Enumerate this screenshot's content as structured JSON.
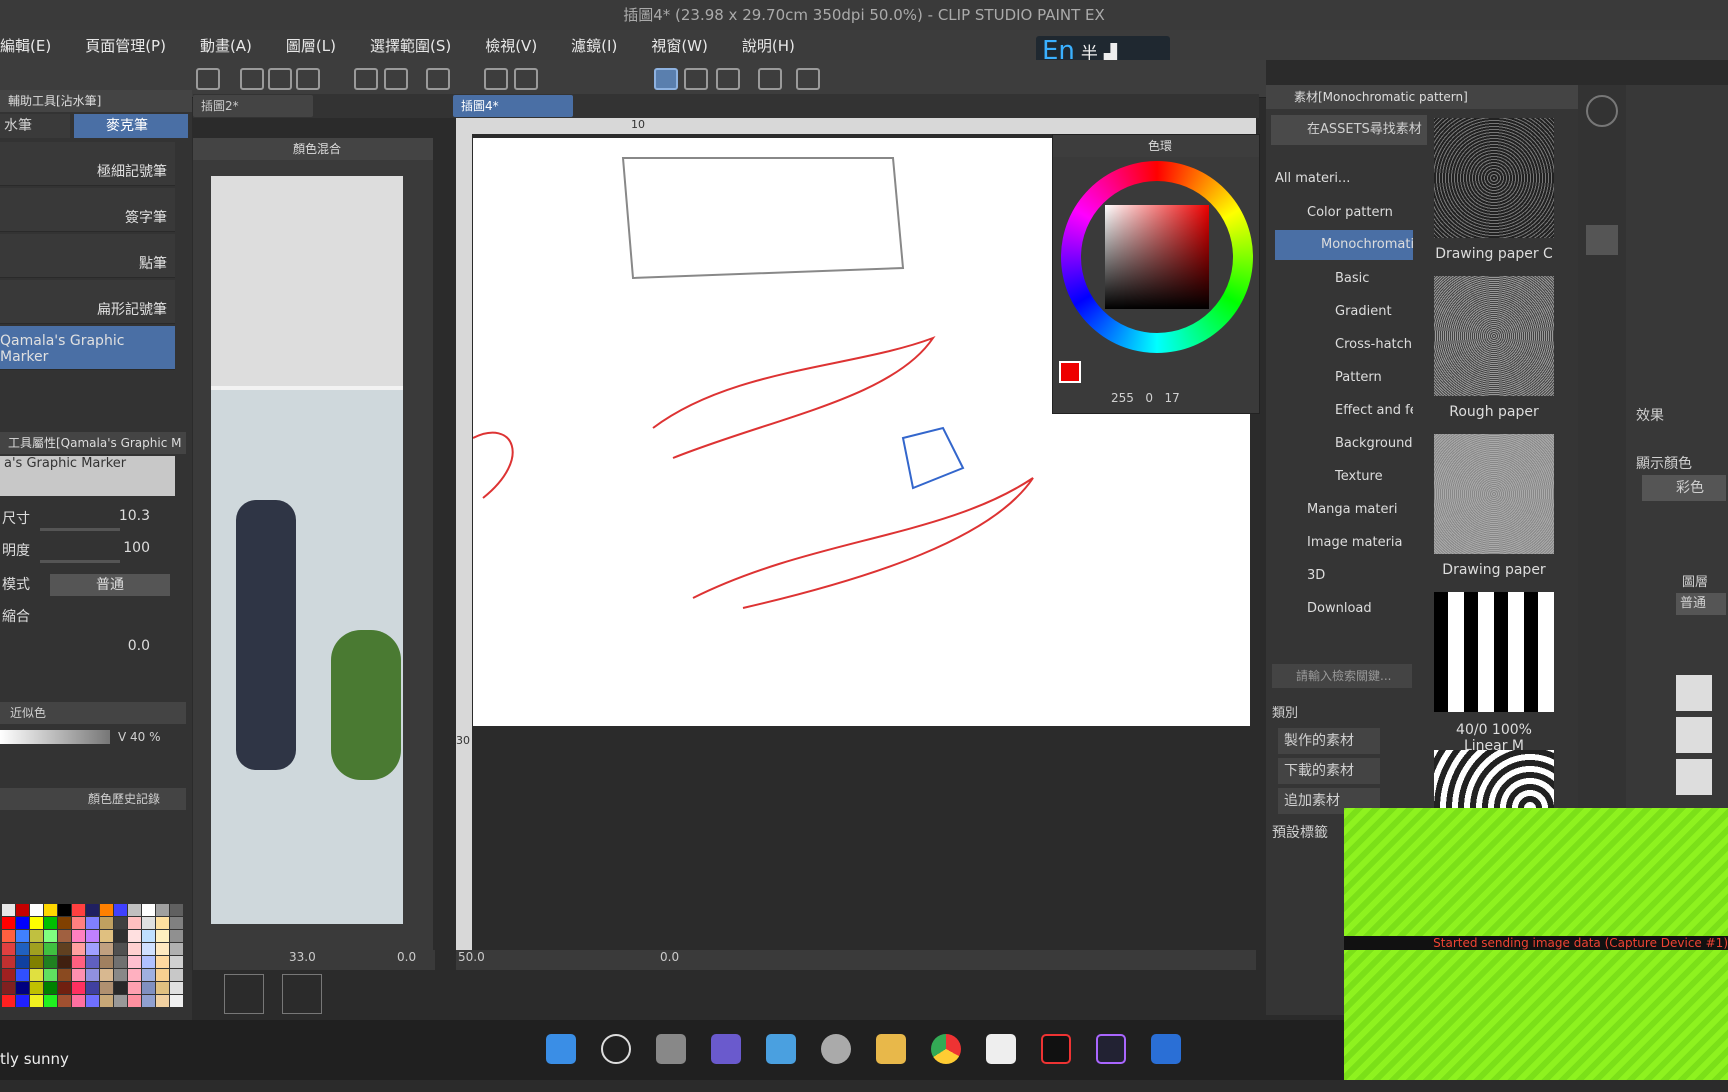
{
  "window": {
    "title": "插圖4* (23.98 x 29.70cm 350dpi 50.0%) - CLIP STUDIO PAINT EX"
  },
  "menu": [
    "編輯(E)",
    "頁面管理(P)",
    "動畫(A)",
    "圖層(L)",
    "選擇範圍(S)",
    "檢視(V)",
    "濾鏡(I)",
    "視窗(W)",
    "說明(H)"
  ],
  "ime": {
    "lang": "En",
    "mode": "半"
  },
  "subtool": {
    "header": "輔助工具[沾水筆]",
    "tab1": "水筆",
    "tab2": "麥克筆",
    "brushes": [
      "極細記號筆",
      "簽字筆",
      "點筆",
      "扁形記號筆",
      "Qamala's Graphic Marker"
    ]
  },
  "tool_property": {
    "header": "工具屬性[Qamala's Graphic M",
    "preview": "a's Graphic Marker",
    "rows": [
      {
        "label": "尺寸",
        "value": "10.3"
      },
      {
        "label": "明度",
        "value": "100"
      },
      {
        "label": "模式",
        "value": "普通"
      },
      {
        "label": "縮合",
        "value": ""
      },
      {
        "label": "",
        "value": "0.0"
      }
    ]
  },
  "color_set": {
    "tab1": "近似色",
    "v_label": "V 40 %",
    "history": "顏色歷史記錄"
  },
  "palette_colors": [
    "#e8e8e8",
    "#c40000",
    "#ffffff",
    "#ffd700",
    "#000000",
    "#ff4040",
    "#202060",
    "#ff8000",
    "#4040ff",
    "#c0c0c0",
    "#ffffff",
    "#a0a0a0",
    "#606060",
    "#ff0000",
    "#0000ff",
    "#ffff00",
    "#00c000",
    "#804000",
    "#ff8080",
    "#8080ff",
    "#c0a060",
    "#404040",
    "#ffc0c0",
    "#e0e0e0",
    "#ffe0a0",
    "#808080",
    "#ff6040",
    "#4080ff",
    "#c0c040",
    "#80ff80",
    "#a06040",
    "#ff80c0",
    "#c080ff",
    "#e0c080",
    "#303030",
    "#ffe0e0",
    "#c0e0ff",
    "#fff0c0",
    "#909090",
    "#e04040",
    "#2060c0",
    "#a0a020",
    "#40c040",
    "#604020",
    "#ffa0a0",
    "#a0a0ff",
    "#c0a080",
    "#505050",
    "#ffd0d0",
    "#d0e0ff",
    "#ffe8c0",
    "#b0b0b0",
    "#c03030",
    "#1040a0",
    "#808000",
    "#208020",
    "#402010",
    "#ff6080",
    "#6060c0",
    "#a08060",
    "#707070",
    "#ffc0d0",
    "#b0c0ff",
    "#ffd8a0",
    "#d0d0d0",
    "#a02020",
    "#3050ff",
    "#e0e040",
    "#60e060",
    "#8a4a20",
    "#ff90b0",
    "#9090e0",
    "#d8b890",
    "#888888",
    "#ffb0c0",
    "#a0b0e0",
    "#f8d090",
    "#c8c8c8",
    "#802020",
    "#000080",
    "#c0c000",
    "#008000",
    "#702010",
    "#ff3060",
    "#4040a0",
    "#b09070",
    "#282828",
    "#ffa0b0",
    "#8090c0",
    "#e0c080",
    "#e0e0e0",
    "#ff2020",
    "#2020ff",
    "#f0f020",
    "#20f020",
    "#a05030",
    "#ff70a0",
    "#7070ff",
    "#c8a878",
    "#989898",
    "#ff90a0",
    "#90a0d0",
    "#f0d0a0",
    "#f0f0f0"
  ],
  "ref_panel": {
    "title": "顏色混合"
  },
  "canvas": {
    "tabs": [
      "插圖2*",
      "插圖4*"
    ],
    "ruler_marks": [
      "10",
      "30"
    ],
    "zoom": "50.0",
    "angle": "0.0",
    "ref_zoom": "33.0",
    "ref_angle": "0.0"
  },
  "color_wheel": {
    "title": "色環",
    "r": "255",
    "g": "0",
    "b": "17"
  },
  "material": {
    "tab": "素材[Monochromatic pattern]",
    "assets_button": "在ASSETS尋找素材",
    "tree": [
      "All materi...",
      "Color pattern",
      "Monochromatic",
      "Basic",
      "Gradient",
      "Cross-hatch",
      "Pattern",
      "Effect and fe",
      "Background",
      "Texture",
      "Manga materi",
      "Image materia",
      "3D",
      "Download"
    ],
    "search_placeholder": "請輸入檢索關鍵...",
    "category_label": "類別",
    "buttons": [
      "製作的素材",
      "下載的素材",
      "追加素材",
      "預設標籤"
    ],
    "thumbs": [
      "Drawing paper C",
      "Rough paper",
      "Drawing paper",
      "40/0 100% Linear M"
    ]
  },
  "right_panel": {
    "effect": "效果",
    "display_color": "顯示顏色",
    "color_mode": "彩色",
    "layer_mode": "普通",
    "tab_layer": "圖層"
  },
  "capture_overlay": {
    "text": "Started sending image data (Capture Device #1)"
  },
  "taskbar": {
    "weather": "tly sunny"
  }
}
